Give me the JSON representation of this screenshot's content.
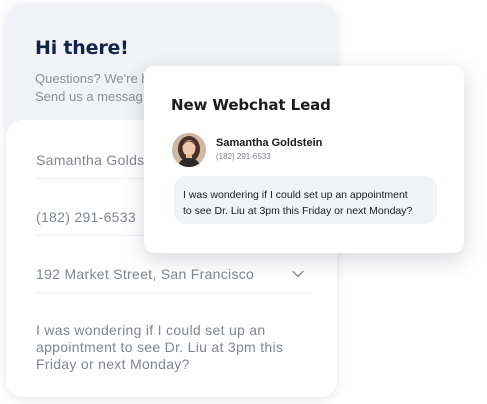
{
  "form": {
    "title": "Hi there!",
    "subtitle": "Questions? We're h\nSend us a messag",
    "fields": {
      "name": "Samantha Goldst",
      "phone": "(182) 291-6533",
      "address": "192 Market Street, San Francisco",
      "message": "I was wondering if I could set up an\nappointment to see Dr. Liu at 3pm this\nFriday or next Monday?"
    }
  },
  "lead": {
    "title": "New Webchat Lead",
    "contact_name": "Samantha Goldstein",
    "contact_phone": "(182) 291-6533",
    "message": "I was wondering if I could set up an appointment\nto see Dr. Liu at 3pm this Friday or next Monday?"
  },
  "icons": {
    "address_dropdown": "chevron-down-icon",
    "avatar": "user-photo"
  },
  "colors": {
    "title": "#15224a",
    "header_bg": "#f1f3f6",
    "bubble_bg": "#f1f3f6",
    "field_text": "#80868f"
  }
}
